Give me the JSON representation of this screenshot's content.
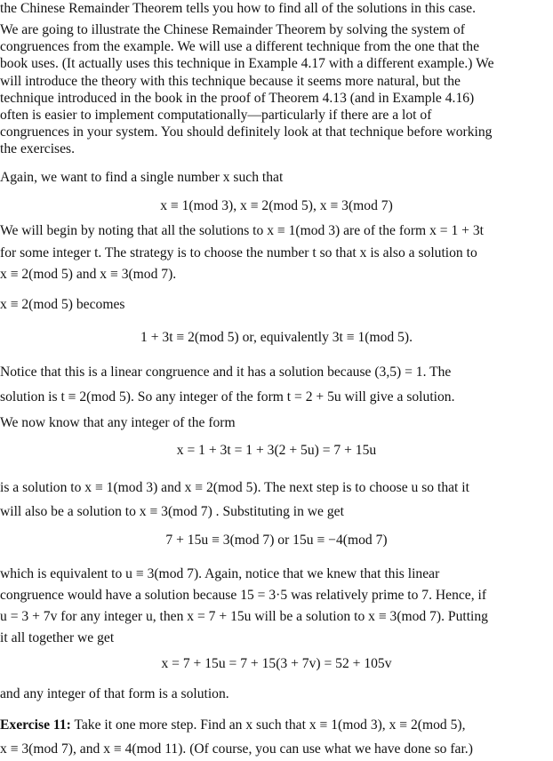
{
  "document": {
    "para0": "the Chinese Remainder Theorem tells you how to find all of the solutions in this case.",
    "para1": [
      "We are going to illustrate the Chinese Remainder Theorem by solving the system of",
      "congruences from the example. We will use a different technique from the one that the",
      "book uses. (It actually uses this technique in Example 4.17 with a different example.) We",
      "will introduce the theory with this technique because it seems more natural, but the",
      "technique introduced in the book in the proof of Theorem 4.13 (and in Example 4.16)",
      "often is easier to implement computationally—particularly if there are a lot of",
      "congruences in your system. You should definitely look at that technique before working",
      "the exercises."
    ],
    "para2": "Again, we want to find a single number x such that",
    "eq1": "x ≡ 1(mod 3),  x ≡ 2(mod 5),  x ≡ 3(mod 7)",
    "para3": [
      "We will begin by noting that all the solutions to  x ≡ 1(mod 3)  are of the form  x = 1 + 3t",
      "for some integer t. The strategy is to choose the number t so that x is also a solution to",
      "x ≡ 2(mod 5)  and  x ≡ 3(mod 7)."
    ],
    "para4": "x ≡ 2(mod 5)  becomes",
    "eq2": "1 + 3t ≡ 2(mod 5)  or, equivalently  3t ≡ 1(mod 5).",
    "para5": [
      "Notice that this is a linear congruence and it has a solution because  (3,5) = 1. The",
      "solution is  t ≡ 2(mod 5). So any integer of the form  t = 2 + 5u  will give a solution."
    ],
    "para6": "We now know that any integer of the form",
    "eq3": "x = 1 + 3t = 1 + 3(2 + 5u) = 7 + 15u",
    "para7": [
      "is a solution to  x ≡ 1(mod 3)  and  x ≡ 2(mod 5). The next step is to choose u so that it",
      "will also be a solution to  x ≡ 3(mod 7) . Substituting in we get"
    ],
    "eq4": "7 + 15u ≡ 3(mod 7)  or  15u ≡ −4(mod 7)",
    "para8": [
      "which is equivalent to  u ≡ 3(mod 7). Again, notice that we knew that this linear",
      "congruence would have a solution because  15 = 3·5  was relatively prime to 7.  Hence, if",
      "u = 3 + 7v  for any integer u, then  x = 7 + 15u  will be a solution to  x ≡ 3(mod 7). Putting",
      "it all together we get"
    ],
    "eq5": "x = 7 + 15u = 7 + 15(3 + 7v) = 52 + 105v",
    "para9": "and any integer of that form is a solution.",
    "exercise": {
      "label": "Exercise 11:",
      "line1": " Take it one more step. Find an x such that  x ≡ 1(mod 3),  x ≡ 2(mod 5),",
      "line2": "x ≡ 3(mod 7), and  x ≡ 4(mod 11). (Of course, you can use what we have done so far.)"
    }
  }
}
